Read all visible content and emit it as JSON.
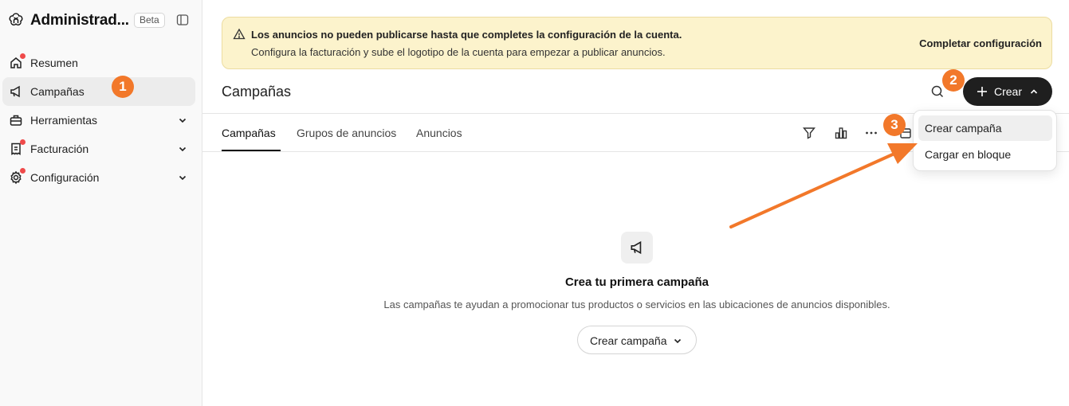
{
  "sidebar": {
    "title": "Administrad...",
    "badge": "Beta",
    "items": [
      {
        "label": "Resumen",
        "icon": "home-icon",
        "alert": true
      },
      {
        "label": "Campañas",
        "icon": "megaphone-icon",
        "alert": false,
        "active": true
      },
      {
        "label": "Herramientas",
        "icon": "toolbox-icon",
        "alert": false,
        "expandable": true
      },
      {
        "label": "Facturación",
        "icon": "receipt-icon",
        "alert": true,
        "expandable": true
      },
      {
        "label": "Configuración",
        "icon": "gear-icon",
        "alert": true,
        "expandable": true
      }
    ]
  },
  "banner": {
    "title": "Los anuncios no pueden publicarse hasta que completes la configuración de la cuenta.",
    "description": "Configura la facturación y sube el logotipo de la cuenta para empezar a publicar anuncios.",
    "action": "Completar configuración"
  },
  "header": {
    "title": "Campañas",
    "create_label": "Crear"
  },
  "tabs": [
    {
      "label": "Campañas",
      "active": true
    },
    {
      "label": "Grupos de anuncios",
      "active": false
    },
    {
      "label": "Anuncios",
      "active": false
    }
  ],
  "dropdown": {
    "items": [
      "Crear campaña",
      "Cargar en bloque"
    ]
  },
  "empty_state": {
    "title": "Crea tu primera campaña",
    "description": "Las campañas te ayudan a promocionar tus productos o servicios en las ubicaciones de anuncios disponibles.",
    "button_label": "Crear campaña"
  },
  "annotations": [
    "1",
    "2",
    "3"
  ],
  "colors": {
    "accent": "#f2782a",
    "alert_dot": "#ef4a4a",
    "banner_bg": "#fcf3cc",
    "primary_button": "#1f1f1f"
  }
}
